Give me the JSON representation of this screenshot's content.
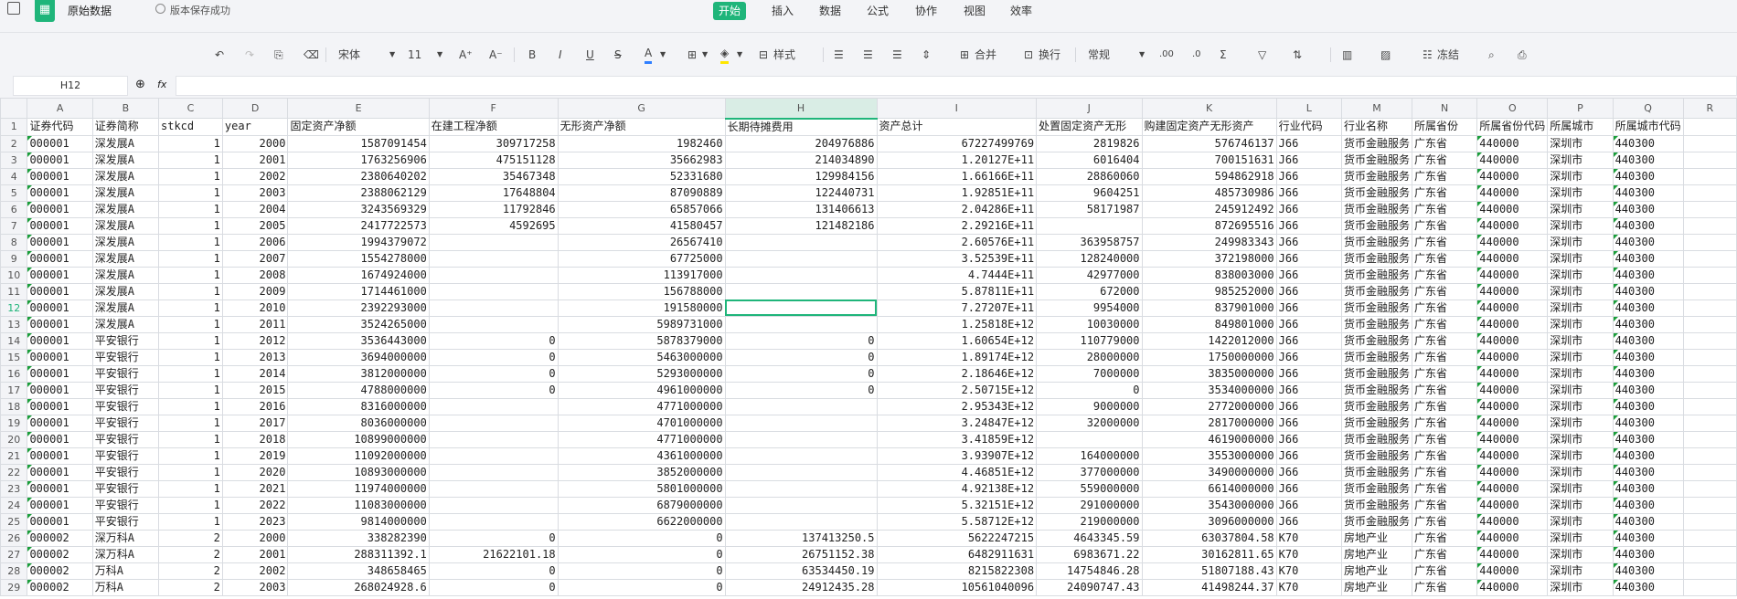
{
  "title": {
    "doc_name": "原始数据",
    "save_status": "版本保存成功"
  },
  "menu_tabs": [
    "开始",
    "插入",
    "数据",
    "公式",
    "协作",
    "视图",
    "效率"
  ],
  "toolbar": {
    "font": "宋体",
    "size": "11",
    "style_label": "样式",
    "merge_label": "合并",
    "wrap_label": "换行",
    "format": "常规",
    "freeze_label": "冻结",
    "bold": "B",
    "italic": "I",
    "underline": "U",
    "strike": "S",
    "font_color": "A",
    "font_color_hex": "#2f7fff",
    "fill_color_hex": "#ffe600",
    "inc_font": "A⁺",
    "dec_font": "A⁻",
    "sum": "Σ"
  },
  "formula_bar": {
    "cell_ref": "H12",
    "fx": "fx",
    "value": ""
  },
  "selected_cell": "H12",
  "columns": [
    "A",
    "B",
    "C",
    "D",
    "E",
    "F",
    "G",
    "H",
    "I",
    "J",
    "K",
    "L",
    "M",
    "N",
    "O",
    "P",
    "Q",
    "R"
  ],
  "header_row": [
    "证券代码",
    "证券简称",
    "stkcd",
    "year",
    "固定资产净额",
    "在建工程净额",
    "无形资产净额",
    "长期待摊费用",
    "资产总计",
    "处置固定资产无形",
    "购建固定资产无形资产",
    "行业代码",
    "行业名称",
    "所属省份",
    "所属省份代码",
    "所属城市",
    "所属城市代码"
  ],
  "rows": [
    [
      "000001",
      "深发展A",
      "1",
      "2000",
      "1587091454",
      "309717258",
      "1982460",
      "204976886",
      "67227499769",
      "2819826",
      "576746137",
      "J66",
      "货币金融服务",
      "广东省",
      "440000",
      "深圳市",
      "440300"
    ],
    [
      "000001",
      "深发展A",
      "1",
      "2001",
      "1763256906",
      "475151128",
      "35662983",
      "214034890",
      "1.20127E+11",
      "6016404",
      "700151631",
      "J66",
      "货币金融服务",
      "广东省",
      "440000",
      "深圳市",
      "440300"
    ],
    [
      "000001",
      "深发展A",
      "1",
      "2002",
      "2380640202",
      "35467348",
      "52331680",
      "129984156",
      "1.66166E+11",
      "28860060",
      "594862918",
      "J66",
      "货币金融服务",
      "广东省",
      "440000",
      "深圳市",
      "440300"
    ],
    [
      "000001",
      "深发展A",
      "1",
      "2003",
      "2388062129",
      "17648804",
      "87090889",
      "122440731",
      "1.92851E+11",
      "9604251",
      "485730986",
      "J66",
      "货币金融服务",
      "广东省",
      "440000",
      "深圳市",
      "440300"
    ],
    [
      "000001",
      "深发展A",
      "1",
      "2004",
      "3243569329",
      "11792846",
      "65857066",
      "131406613",
      "2.04286E+11",
      "58171987",
      "245912492",
      "J66",
      "货币金融服务",
      "广东省",
      "440000",
      "深圳市",
      "440300"
    ],
    [
      "000001",
      "深发展A",
      "1",
      "2005",
      "2417722573",
      "4592695",
      "41580457",
      "121482186",
      "2.29216E+11",
      "",
      "872695516",
      "J66",
      "货币金融服务",
      "广东省",
      "440000",
      "深圳市",
      "440300"
    ],
    [
      "000001",
      "深发展A",
      "1",
      "2006",
      "1994379072",
      "",
      "26567410",
      "",
      "2.60576E+11",
      "363958757",
      "249983343",
      "J66",
      "货币金融服务",
      "广东省",
      "440000",
      "深圳市",
      "440300"
    ],
    [
      "000001",
      "深发展A",
      "1",
      "2007",
      "1554278000",
      "",
      "67725000",
      "",
      "3.52539E+11",
      "128240000",
      "372198000",
      "J66",
      "货币金融服务",
      "广东省",
      "440000",
      "深圳市",
      "440300"
    ],
    [
      "000001",
      "深发展A",
      "1",
      "2008",
      "1674924000",
      "",
      "113917000",
      "",
      "4.7444E+11",
      "42977000",
      "838003000",
      "J66",
      "货币金融服务",
      "广东省",
      "440000",
      "深圳市",
      "440300"
    ],
    [
      "000001",
      "深发展A",
      "1",
      "2009",
      "1714461000",
      "",
      "156788000",
      "",
      "5.87811E+11",
      "672000",
      "985252000",
      "J66",
      "货币金融服务",
      "广东省",
      "440000",
      "深圳市",
      "440300"
    ],
    [
      "000001",
      "深发展A",
      "1",
      "2010",
      "2392293000",
      "",
      "191580000",
      "",
      "7.27207E+11",
      "9954000",
      "837901000",
      "J66",
      "货币金融服务",
      "广东省",
      "440000",
      "深圳市",
      "440300"
    ],
    [
      "000001",
      "深发展A",
      "1",
      "2011",
      "3524265000",
      "",
      "5989731000",
      "",
      "1.25818E+12",
      "10030000",
      "849801000",
      "J66",
      "货币金融服务",
      "广东省",
      "440000",
      "深圳市",
      "440300"
    ],
    [
      "000001",
      "平安银行",
      "1",
      "2012",
      "3536443000",
      "0",
      "5878379000",
      "0",
      "1.60654E+12",
      "110779000",
      "1422012000",
      "J66",
      "货币金融服务",
      "广东省",
      "440000",
      "深圳市",
      "440300"
    ],
    [
      "000001",
      "平安银行",
      "1",
      "2013",
      "3694000000",
      "0",
      "5463000000",
      "0",
      "1.89174E+12",
      "28000000",
      "1750000000",
      "J66",
      "货币金融服务",
      "广东省",
      "440000",
      "深圳市",
      "440300"
    ],
    [
      "000001",
      "平安银行",
      "1",
      "2014",
      "3812000000",
      "0",
      "5293000000",
      "0",
      "2.18646E+12",
      "7000000",
      "3835000000",
      "J66",
      "货币金融服务",
      "广东省",
      "440000",
      "深圳市",
      "440300"
    ],
    [
      "000001",
      "平安银行",
      "1",
      "2015",
      "4788000000",
      "0",
      "4961000000",
      "0",
      "2.50715E+12",
      "0",
      "3534000000",
      "J66",
      "货币金融服务",
      "广东省",
      "440000",
      "深圳市",
      "440300"
    ],
    [
      "000001",
      "平安银行",
      "1",
      "2016",
      "8316000000",
      "",
      "4771000000",
      "",
      "2.95343E+12",
      "9000000",
      "2772000000",
      "J66",
      "货币金融服务",
      "广东省",
      "440000",
      "深圳市",
      "440300"
    ],
    [
      "000001",
      "平安银行",
      "1",
      "2017",
      "8036000000",
      "",
      "4701000000",
      "",
      "3.24847E+12",
      "32000000",
      "2817000000",
      "J66",
      "货币金融服务",
      "广东省",
      "440000",
      "深圳市",
      "440300"
    ],
    [
      "000001",
      "平安银行",
      "1",
      "2018",
      "10899000000",
      "",
      "4771000000",
      "",
      "3.41859E+12",
      "",
      "4619000000",
      "J66",
      "货币金融服务",
      "广东省",
      "440000",
      "深圳市",
      "440300"
    ],
    [
      "000001",
      "平安银行",
      "1",
      "2019",
      "11092000000",
      "",
      "4361000000",
      "",
      "3.93907E+12",
      "164000000",
      "3553000000",
      "J66",
      "货币金融服务",
      "广东省",
      "440000",
      "深圳市",
      "440300"
    ],
    [
      "000001",
      "平安银行",
      "1",
      "2020",
      "10893000000",
      "",
      "3852000000",
      "",
      "4.46851E+12",
      "377000000",
      "3490000000",
      "J66",
      "货币金融服务",
      "广东省",
      "440000",
      "深圳市",
      "440300"
    ],
    [
      "000001",
      "平安银行",
      "1",
      "2021",
      "11974000000",
      "",
      "5801000000",
      "",
      "4.92138E+12",
      "559000000",
      "6614000000",
      "J66",
      "货币金融服务",
      "广东省",
      "440000",
      "深圳市",
      "440300"
    ],
    [
      "000001",
      "平安银行",
      "1",
      "2022",
      "11083000000",
      "",
      "6879000000",
      "",
      "5.32151E+12",
      "291000000",
      "3543000000",
      "J66",
      "货币金融服务",
      "广东省",
      "440000",
      "深圳市",
      "440300"
    ],
    [
      "000001",
      "平安银行",
      "1",
      "2023",
      "9814000000",
      "",
      "6622000000",
      "",
      "5.58712E+12",
      "219000000",
      "3096000000",
      "J66",
      "货币金融服务",
      "广东省",
      "440000",
      "深圳市",
      "440300"
    ],
    [
      "000002",
      "深万科A",
      "2",
      "2000",
      "338282390",
      "0",
      "0",
      "137413250.5",
      "5622247215",
      "4643345.59",
      "63037804.58",
      "K70",
      "房地产业",
      "广东省",
      "440000",
      "深圳市",
      "440300"
    ],
    [
      "000002",
      "深万科A",
      "2",
      "2001",
      "288311392.1",
      "21622101.18",
      "0",
      "26751152.38",
      "6482911631",
      "6983671.22",
      "30162811.65",
      "K70",
      "房地产业",
      "广东省",
      "440000",
      "深圳市",
      "440300"
    ],
    [
      "000002",
      "万科A",
      "2",
      "2002",
      "348658465",
      "0",
      "0",
      "63534450.19",
      "8215822308",
      "14754846.28",
      "51807188.43",
      "K70",
      "房地产业",
      "广东省",
      "440000",
      "深圳市",
      "440300"
    ],
    [
      "000002",
      "万科A",
      "2",
      "2003",
      "268024928.6",
      "0",
      "0",
      "24912435.28",
      "10561040096",
      "24090747.43",
      "41498244.37",
      "K70",
      "房地产业",
      "广东省",
      "440000",
      "深圳市",
      "440300"
    ]
  ]
}
